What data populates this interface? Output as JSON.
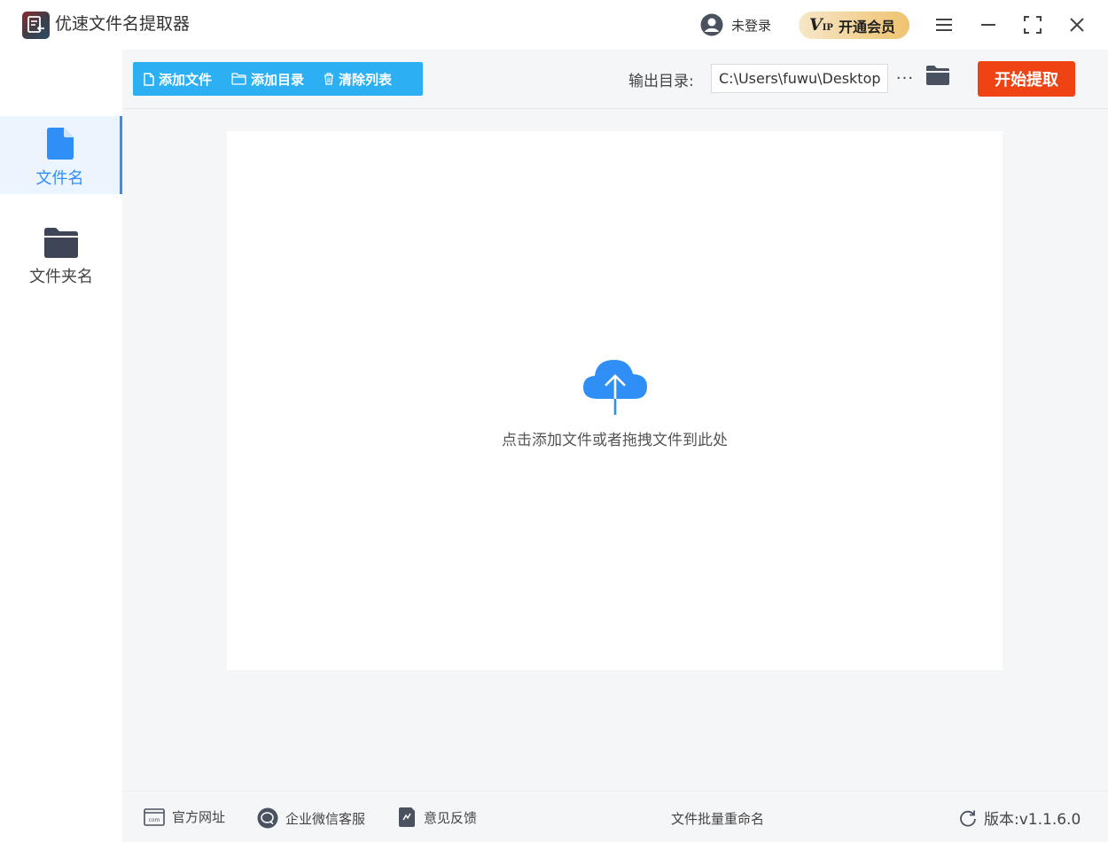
{
  "app": {
    "title": "优速文件名提取器",
    "logo_icon": "app-logo-icon"
  },
  "header": {
    "user_label": "未登录",
    "vip_mark": "V",
    "vip_sub": "IP",
    "vip_label": "开通会员"
  },
  "sidebar": {
    "items": [
      {
        "label": "文件名",
        "icon": "file-icon",
        "active": true
      },
      {
        "label": "文件夹名",
        "icon": "folder-icon",
        "active": false
      }
    ]
  },
  "toolbar": {
    "add_file": "添加文件",
    "add_dir": "添加目录",
    "clear_list": "清除列表",
    "output_label": "输出目录:",
    "output_path": "C:\\Users\\fuwu\\Desktop",
    "more": "···",
    "start": "开始提取"
  },
  "dropzone": {
    "hint": "点击添加文件或者拖拽文件到此处",
    "icon": "cloud-upload-icon"
  },
  "footer": {
    "website": "官方网址",
    "wechat": "企业微信客服",
    "feedback": "意见反馈",
    "center": "文件批量重命名",
    "version": "版本:v1.1.6.0"
  },
  "colors": {
    "accent": "#2f8ff7",
    "toolbar_blue": "#2db0f3",
    "start_red": "#f04314",
    "vip_gold": "#efc26e",
    "background": "#f5f6f8"
  }
}
